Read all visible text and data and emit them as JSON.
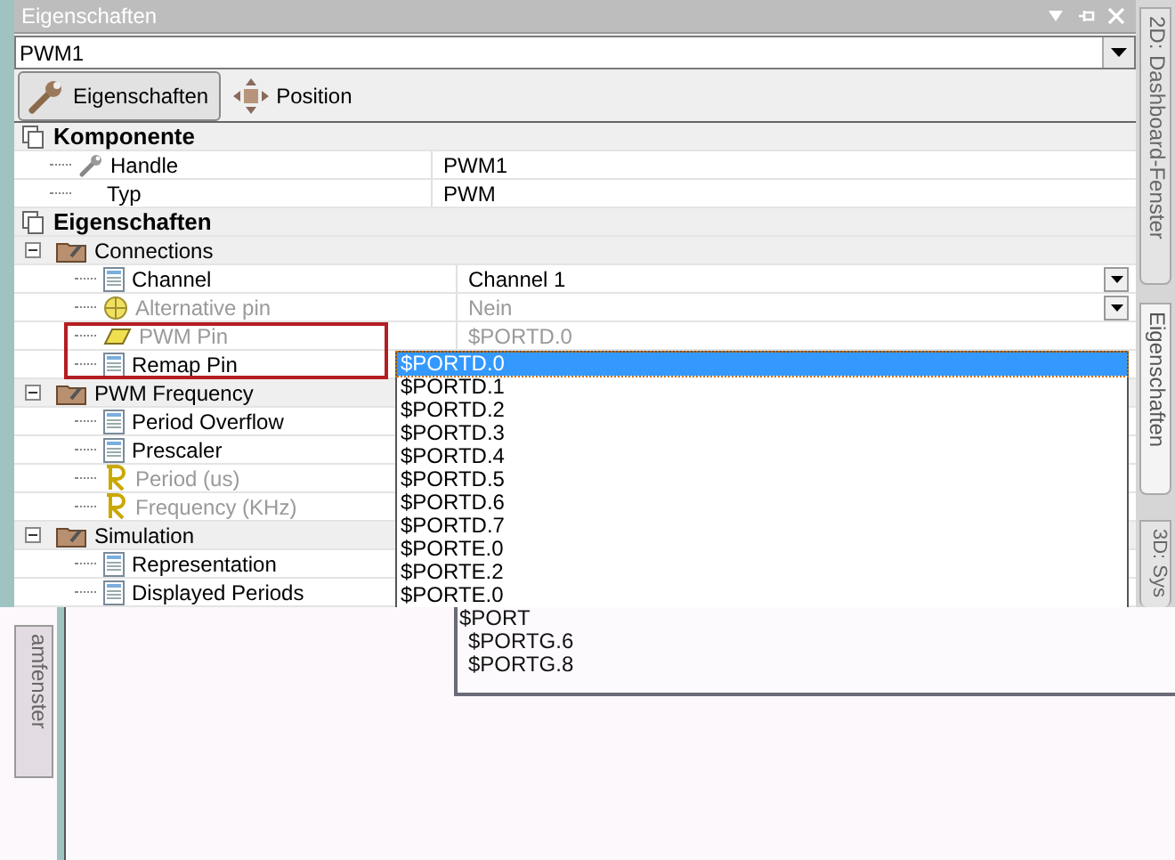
{
  "panel": {
    "title": "Eigenschaften"
  },
  "object_selector": {
    "value": "PWM1"
  },
  "tabs": [
    {
      "label": "Eigenschaften",
      "kind": "wrench",
      "selected": true
    },
    {
      "label": "Position",
      "kind": "move",
      "selected": false
    }
  ],
  "grid": [
    {
      "label": "Komponente",
      "children": [
        {
          "label": "Handle",
          "kind": "wrench",
          "value": "PWM1",
          "disabled": false
        },
        {
          "label": "Typ",
          "value": "PWM",
          "disabled": false
        }
      ]
    },
    {
      "label": "Eigenschaften",
      "children": [
        {
          "label": "Connections",
          "expanded": true,
          "children": [
            {
              "label": "Channel",
              "kind": "doc",
              "value": "Channel 1",
              "dropdown": true,
              "disabled": false
            },
            {
              "label": "Alternative pin",
              "kind": "target",
              "value": "Nein",
              "dropdown": true,
              "disabled": true
            },
            {
              "label": "PWM Pin",
              "kind": "pin",
              "value": "$PORTD.0",
              "disabled": true,
              "highlighted": true
            },
            {
              "label": "Remap Pin",
              "kind": "doc",
              "disabled": false,
              "highlighted": true
            }
          ]
        },
        {
          "label": "PWM Frequency",
          "expanded": true,
          "children": [
            {
              "label": "Period Overflow",
              "kind": "doc",
              "disabled": false
            },
            {
              "label": "Prescaler",
              "kind": "doc",
              "disabled": false
            },
            {
              "label": "Period (us)",
              "kind": "r",
              "disabled": true
            },
            {
              "label": "Frequency (KHz)",
              "kind": "r",
              "disabled": true
            }
          ]
        },
        {
          "label": "Simulation",
          "expanded": true,
          "children": [
            {
              "label": "Representation",
              "kind": "doc",
              "disabled": false
            },
            {
              "label": "Displayed Periods",
              "kind": "doc",
              "disabled": false
            }
          ]
        }
      ]
    }
  ],
  "dropdown_list": [
    {
      "label": "$PORTD.0",
      "selected": true
    },
    {
      "label": "$PORTD.1",
      "selected": false
    },
    {
      "label": "$PORTD.2",
      "selected": false
    },
    {
      "label": "$PORTD.3",
      "selected": false
    },
    {
      "label": "$PORTD.4",
      "selected": false
    },
    {
      "label": "$PORTD.5",
      "selected": false
    },
    {
      "label": "$PORTD.6",
      "selected": false
    },
    {
      "label": "$PORTD.7",
      "selected": false
    },
    {
      "label": "$PORTE.0",
      "selected": false
    },
    {
      "label": "$PORTE.2",
      "selected": false
    },
    {
      "label": "$PORTE.0",
      "selected": false
    }
  ],
  "ghost_list": [
    "$PORT",
    "$PORTG.6",
    "$PORTG.8"
  ],
  "side_tabs": [
    {
      "label": "2D: Dashboard-Fenster",
      "selected": false
    },
    {
      "label": "Eigenschaften",
      "selected": true
    },
    {
      "label": "3D: Sys",
      "selected": false
    }
  ],
  "lower_tab": {
    "label": "amfenster"
  }
}
